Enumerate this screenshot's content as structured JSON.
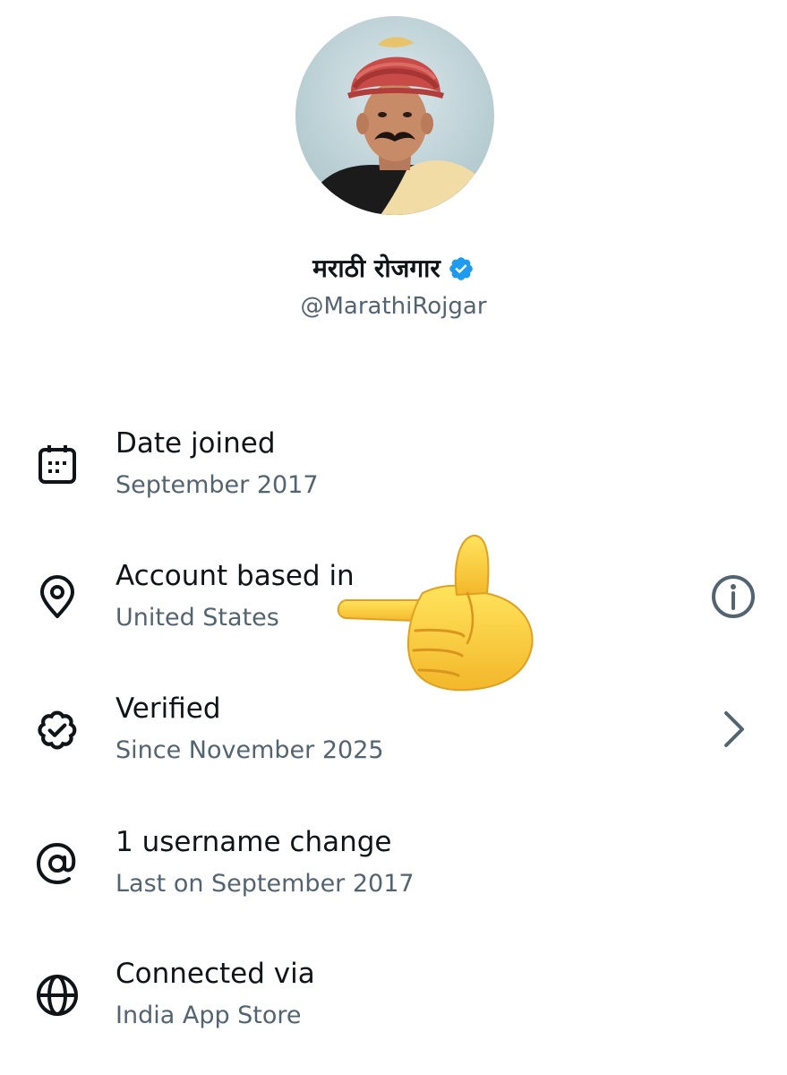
{
  "profile": {
    "display_name": "मराठी रोजगार",
    "handle": "@MarathiRojgar",
    "verified_color": "#1d9bf0",
    "avatar_icon": "profile-photo"
  },
  "about_rows": [
    {
      "icon": "calendar-icon",
      "title": "Date joined",
      "subtitle": "September 2017",
      "trailing": null
    },
    {
      "icon": "location-pin-icon",
      "title": "Account based in",
      "subtitle": "United States",
      "trailing": "info-icon"
    },
    {
      "icon": "verified-badge-outline-icon",
      "title": "Verified",
      "subtitle": "Since November 2025",
      "trailing": "chevron-right-icon"
    },
    {
      "icon": "at-sign-icon",
      "title": "1 username change",
      "subtitle": "Last on September 2017",
      "trailing": null
    },
    {
      "icon": "globe-icon",
      "title": "Connected via",
      "subtitle": "India App Store",
      "trailing": null
    }
  ],
  "overlay": {
    "icon": "pointing-hand-emoji"
  },
  "colors": {
    "primary_text": "#0f1419",
    "secondary_text": "#536471",
    "accent": "#1d9bf0"
  }
}
